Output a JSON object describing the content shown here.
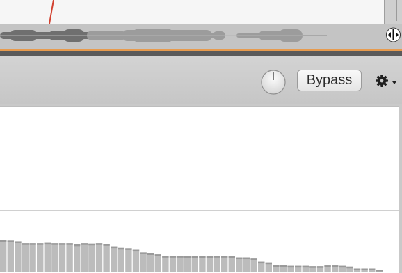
{
  "header": {
    "bypass_label": "Bypass"
  },
  "icons": {
    "mix_knob": "knob-icon",
    "settings": "gear-icon",
    "split": "split-arrows-icon"
  },
  "colors": {
    "playhead": "#d2412f",
    "track_divider": "#e79b4e",
    "waveform_played": "#6f6f6f",
    "waveform_unplayed": "#9c9c9c",
    "bar_fill": "#bcbcbc",
    "bar_cap": "#9a9a9a"
  },
  "spectrum": {
    "levels": [
      0.84,
      0.83,
      0.81,
      0.76,
      0.76,
      0.76,
      0.77,
      0.76,
      0.76,
      0.76,
      0.73,
      0.76,
      0.75,
      0.76,
      0.74,
      0.68,
      0.64,
      0.63,
      0.59,
      0.52,
      0.5,
      0.47,
      0.43,
      0.43,
      0.43,
      0.42,
      0.42,
      0.42,
      0.42,
      0.43,
      0.43,
      0.42,
      0.39,
      0.39,
      0.36,
      0.28,
      0.26,
      0.19,
      0.19,
      0.17,
      0.17,
      0.17,
      0.16,
      0.16,
      0.18,
      0.18,
      0.17,
      0.15,
      0.1,
      0.1,
      0.1,
      0.07
    ]
  }
}
